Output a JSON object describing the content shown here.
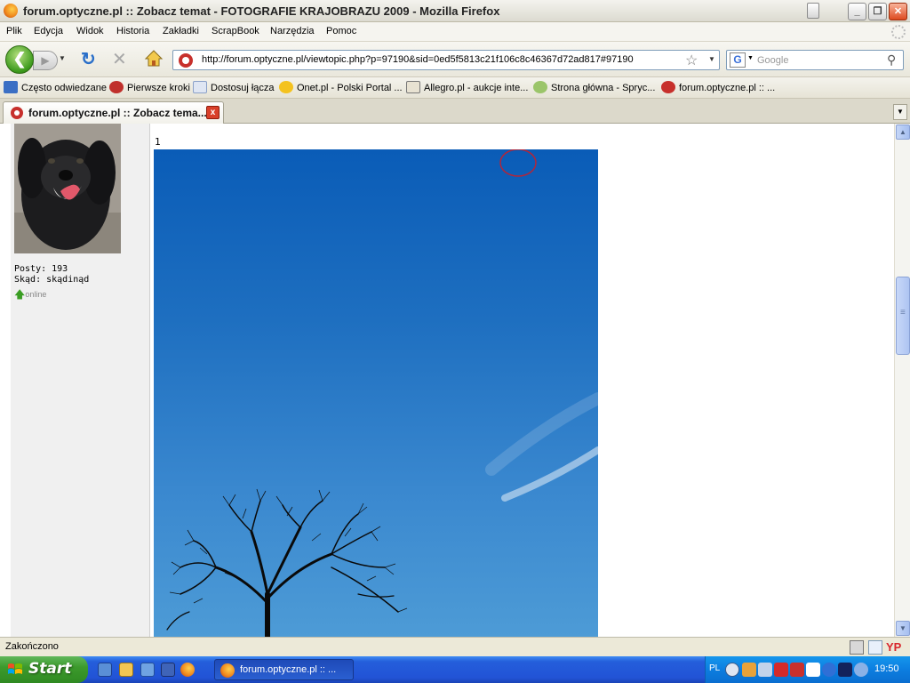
{
  "window": {
    "title": "forum.optyczne.pl :: Zobacz temat - FOTOGRAFIE KRAJOBRAZU 2009 - Mozilla Firefox",
    "minimize_icon": "minimize-icon",
    "restore_icon": "restore-icon",
    "close_icon": "close-icon"
  },
  "menu": {
    "items": [
      {
        "label": "Plik"
      },
      {
        "label": "Edycja"
      },
      {
        "label": "Widok"
      },
      {
        "label": "Historia"
      },
      {
        "label": "Zakładki"
      },
      {
        "label": "ScrapBook"
      },
      {
        "label": "Narzędzia"
      },
      {
        "label": "Pomoc"
      }
    ]
  },
  "navigation": {
    "url": "http://forum.optyczne.pl/viewtopic.php?p=97190&sid=0ed5f5813c21f106c8c46367d72ad817#97190",
    "search_placeholder": "Google",
    "search_engine_letter": "G"
  },
  "bookmarks": [
    {
      "label": "Często odwiedzane",
      "icon": "bookmark-folder-icon",
      "color": "#3b6fc4"
    },
    {
      "label": "Pierwsze kroki",
      "icon": "firefox-bookmark-icon",
      "color": "#c0302c"
    },
    {
      "label": "Dostosuj łącza",
      "icon": "page-icon",
      "color": "#dfe6f3"
    },
    {
      "label": "Onet.pl - Polski Portal ...",
      "icon": "onet-icon",
      "color": "#f4c21f"
    },
    {
      "label": "Allegro.pl - aukcje inte...",
      "icon": "allegro-icon",
      "color": "#e8e2d2"
    },
    {
      "label": "Strona główna - Spryc...",
      "icon": "spryciarze-icon",
      "color": "#9bc56a"
    },
    {
      "label": "forum.optyczne.pl :: ...",
      "icon": "optyczne-icon",
      "color": "#c7302c"
    }
  ],
  "tab": {
    "label": "forum.optyczne.pl :: Zobacz tema...",
    "close_glyph": "x"
  },
  "post": {
    "posts_label": "Posty: 193",
    "from_label": "Skąd: skądinąd",
    "online_label": "online",
    "image_number": "1"
  },
  "status": {
    "text": "Zakończono"
  },
  "taskbar": {
    "start_label": "Start",
    "task_label": "forum.optyczne.pl :: ...",
    "lang": "PL",
    "clock": "19:50"
  },
  "colors": {
    "sky_top": "#0a5cb7",
    "sky_bottom": "#4d9bd6",
    "taskbar_blue": "#245edb",
    "start_green": "#3c9a2c"
  }
}
